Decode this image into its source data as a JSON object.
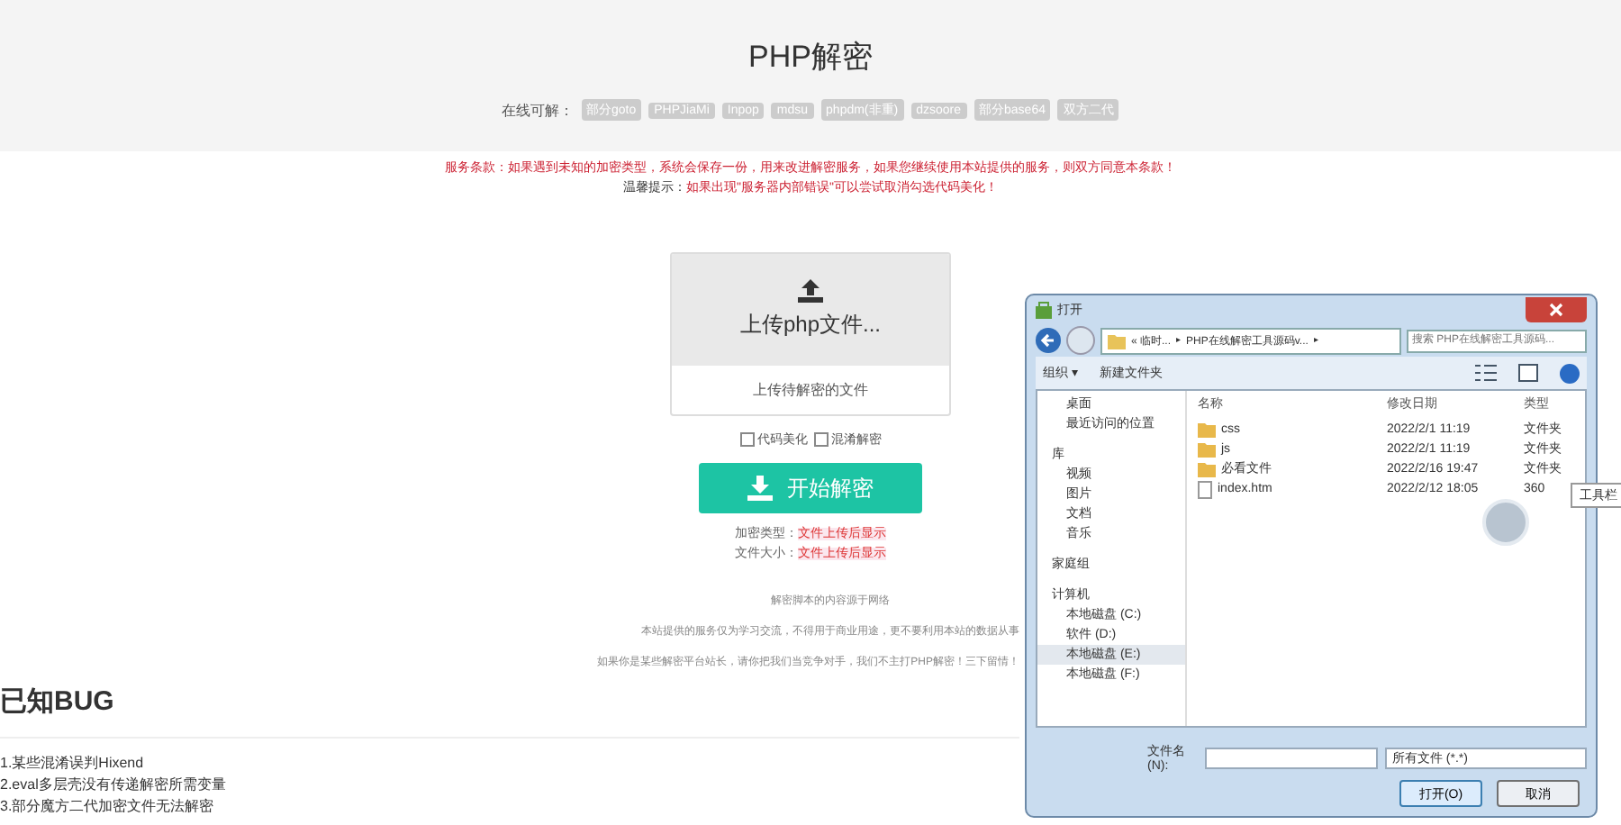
{
  "header": {
    "title": "PHP解密",
    "tags_label": "在线可解：",
    "tags": [
      "部分goto",
      "PHPJiaMi",
      "Inpop",
      "mdsu",
      "phpdm(非重)",
      "dzsoore",
      "部分base64",
      "双方二代"
    ]
  },
  "notices": [
    {
      "label": "服务条款：",
      "text": "如果遇到未知的加密类型，系统会保存一份，用来改进解密服务，如果您继续使用本站提供的服务，则双方同意本条款！",
      "kind": "warning"
    },
    {
      "label": "温馨提示：",
      "text": "如果出现\"服务器内部错误\"可以尝试取消勾选代码美化！",
      "kind": "tip"
    }
  ],
  "upload": {
    "title": "上传php文件...",
    "hint": "上传待解密的文件"
  },
  "options": [
    {
      "label": "代码美化",
      "checked": false
    },
    {
      "label": "混淆解密",
      "checked": false
    }
  ],
  "decrypt_button": "开始解密",
  "info": [
    {
      "label": "加密类型：",
      "value": "文件上传后显示"
    },
    {
      "label": "文件大小：",
      "value": "文件上传后显示"
    }
  ],
  "footnotes": [
    "解密脚本的内容源于网络",
    "本站提供的服务仅为学习交流，不得用于商业用途，更不要利用本站的数据从事",
    "如果你是某些解密平台站长，请你把我们当竞争对手，我们不主打PHP解密！三下留情！"
  ],
  "bugs": {
    "title": "已知BUG",
    "items": [
      "1.某些混淆误判Hixend",
      "2.eval多层壳没有传递解密所需变量",
      "3.部分魔方二代加密文件无法解密"
    ]
  },
  "dialog": {
    "title": "打开",
    "breadcrumb": [
      "« 临时...",
      "PHP在线解密工具源码v..."
    ],
    "separator": "▸",
    "search_placeholder": "搜索 PHP在线解密工具源码...",
    "toolbar": [
      "组织 ▾",
      "新建文件夹"
    ],
    "nav": [
      {
        "label": "桌面",
        "kind": "item",
        "selected": false
      },
      {
        "label": "最近访问的位置",
        "kind": "item",
        "selected": false
      },
      {
        "label": "库",
        "kind": "group",
        "selected": false
      },
      {
        "label": "视频",
        "kind": "item",
        "selected": false
      },
      {
        "label": "图片",
        "kind": "item",
        "selected": false
      },
      {
        "label": "文档",
        "kind": "item",
        "selected": false
      },
      {
        "label": "音乐",
        "kind": "item",
        "selected": false
      },
      {
        "label": "家庭组",
        "kind": "group",
        "selected": false
      },
      {
        "label": "计算机",
        "kind": "group",
        "selected": false
      },
      {
        "label": "本地磁盘 (C:)",
        "kind": "item",
        "selected": false
      },
      {
        "label": "软件 (D:)",
        "kind": "item",
        "selected": false
      },
      {
        "label": "本地磁盘 (E:)",
        "kind": "item",
        "selected": true
      },
      {
        "label": "本地磁盘 (F:)",
        "kind": "item",
        "selected": false
      }
    ],
    "columns": [
      "名称",
      "修改日期",
      "类型"
    ],
    "files": [
      {
        "name": "css",
        "date": "2022/2/1 11:19",
        "type": "文件夹",
        "kind": "folder"
      },
      {
        "name": "js",
        "date": "2022/2/1 11:19",
        "type": "文件夹",
        "kind": "folder"
      },
      {
        "name": "必看文件",
        "date": "2022/2/16 19:47",
        "type": "文件夹",
        "kind": "folder"
      },
      {
        "name": "index.htm",
        "date": "2022/2/12 18:05",
        "type": "360",
        "kind": "file"
      }
    ],
    "filename_label": "文件名(N):",
    "filetype": "所有文件 (*.*)",
    "open_button": "打开(O)",
    "cancel_button": "取消"
  },
  "tooltip": "工具栏"
}
